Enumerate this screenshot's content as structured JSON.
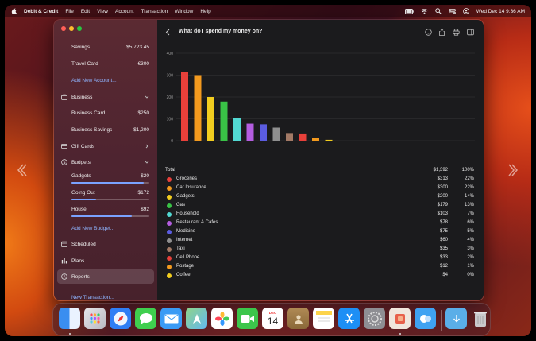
{
  "menubar": {
    "app": "Debit & Credit",
    "items": [
      "File",
      "Edit",
      "View",
      "Account",
      "Transaction",
      "Window",
      "Help"
    ],
    "clock": "Wed Dec 14  9:36 AM"
  },
  "sidebar": {
    "top_accounts": [
      {
        "label": "Savings",
        "amount": "$5,723.45"
      },
      {
        "label": "Travel Card",
        "amount": "€300"
      }
    ],
    "add_account": "Add New Account...",
    "business": {
      "label": "Business",
      "accounts": [
        {
          "label": "Business Card",
          "amount": "$250"
        },
        {
          "label": "Business Savings",
          "amount": "$1,200"
        }
      ]
    },
    "gift_cards": "Gift Cards",
    "budgets": {
      "label": "Budgets",
      "items": [
        {
          "label": "Gadgets",
          "amount": "$20",
          "progress": 0.93
        },
        {
          "label": "Going Out",
          "amount": "$172",
          "progress": 0.32
        },
        {
          "label": "House",
          "amount": "$92",
          "progress": 0.78
        }
      ],
      "add_budget": "Add New Budget..."
    },
    "scheduled": "Scheduled",
    "plans": "Plans",
    "reports": "Reports",
    "new_transaction": "New Transaction..."
  },
  "main": {
    "title": "What do I spend my money on?",
    "total_label": "Total",
    "total_value": "$1,392",
    "total_pct": "100%",
    "categories": [
      {
        "name": "Groceries",
        "value": "$313",
        "pct": "22%",
        "color": "#e8403a"
      },
      {
        "name": "Car Insurance",
        "value": "$300",
        "pct": "22%",
        "color": "#f39a1e"
      },
      {
        "name": "Gadgets",
        "value": "$200",
        "pct": "14%",
        "color": "#f2cd1f"
      },
      {
        "name": "Gas",
        "value": "$179",
        "pct": "13%",
        "color": "#39c246"
      },
      {
        "name": "Household",
        "value": "$103",
        "pct": "7%",
        "color": "#52d9d2"
      },
      {
        "name": "Restaurant & Cafes",
        "value": "$78",
        "pct": "6%",
        "color": "#b45de0"
      },
      {
        "name": "Medicine",
        "value": "$75",
        "pct": "5%",
        "color": "#5b5ce0"
      },
      {
        "name": "Internet",
        "value": "$60",
        "pct": "4%",
        "color": "#8f8f8f"
      },
      {
        "name": "Taxi",
        "value": "$35",
        "pct": "3%",
        "color": "#a37a66"
      },
      {
        "name": "Cell Phone",
        "value": "$33",
        "pct": "2%",
        "color": "#e8403a"
      },
      {
        "name": "Postage",
        "value": "$12",
        "pct": "1%",
        "color": "#f39a1e"
      },
      {
        "name": "Coffee",
        "value": "$4",
        "pct": "0%",
        "color": "#f2cd1f"
      }
    ]
  },
  "chart_data": {
    "type": "bar",
    "categories": [
      "Groceries",
      "Car Insurance",
      "Gadgets",
      "Gas",
      "Household",
      "Restaurant & Cafes",
      "Medicine",
      "Internet",
      "Taxi",
      "Cell Phone",
      "Postage",
      "Coffee"
    ],
    "values": [
      313,
      300,
      200,
      179,
      103,
      78,
      75,
      60,
      35,
      33,
      12,
      4
    ],
    "colors": [
      "#e8403a",
      "#f39a1e",
      "#f2cd1f",
      "#39c246",
      "#52d9d2",
      "#b45de0",
      "#5b5ce0",
      "#8f8f8f",
      "#a37a66",
      "#e8403a",
      "#f39a1e",
      "#f2cd1f"
    ],
    "yticks": [
      "0",
      "100",
      "200",
      "300",
      "400"
    ],
    "ylim": [
      0,
      400
    ],
    "grid": true
  },
  "dock": {
    "calendar_month": "DEC",
    "calendar_day": "14"
  }
}
